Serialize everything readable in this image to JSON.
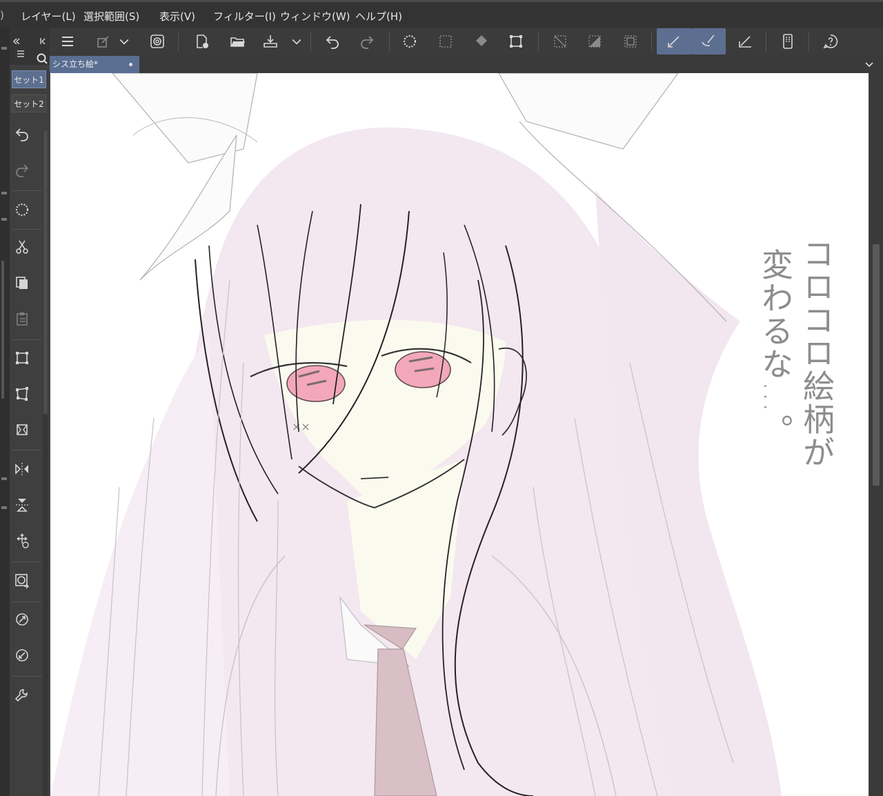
{
  "menu": {
    "leading": ")",
    "items": [
      "レイヤー(L)",
      "選択範囲(S)",
      "表示(V)",
      "フィルター(I)",
      "ウィンドウ(W)",
      "ヘルプ(H)"
    ]
  },
  "toolbar": {
    "items": [
      "menu-icon",
      "eraser-icon",
      "chevron-down-icon",
      "spiral-icon",
      "new-document-icon",
      "open-folder-icon",
      "save-icon",
      "chevron-down-icon",
      "undo-icon",
      "redo-icon",
      "select-all-icon",
      "deselect-icon",
      "fill-icon",
      "transform-icon",
      "clear-icon",
      "invert-selection-icon",
      "frame-icon",
      "pen-pressure-icon",
      "brush-icon",
      "ruler-icon",
      "smartphone-icon",
      "help-icon"
    ]
  },
  "tab": {
    "title": "シス立ち絵*"
  },
  "tool_panel": {
    "sets": [
      "セット1",
      "セット2"
    ],
    "active_set": "セット1",
    "tools": [
      "undo-icon",
      "redo-icon",
      "select-all-icon",
      "cut-icon",
      "copy-icon",
      "paste-icon",
      "scale-icon",
      "free-transform-icon",
      "perspective-icon",
      "flip-horizontal-icon",
      "flip-vertical-icon",
      "move-rotate-icon",
      "layer-transform-icon",
      "rotate-left-icon",
      "rotate-right-icon",
      "wrench-icon"
    ]
  },
  "canvas": {
    "handwriting_right": "コロコロ絵柄が",
    "handwriting_left": "変わるな…。"
  },
  "colors": {
    "accent": "#5c6f90",
    "hair": "#f1e4ee",
    "eyes": "#f2a8b8",
    "tie": "#d9bfc6",
    "skin": "#fbfaef"
  }
}
